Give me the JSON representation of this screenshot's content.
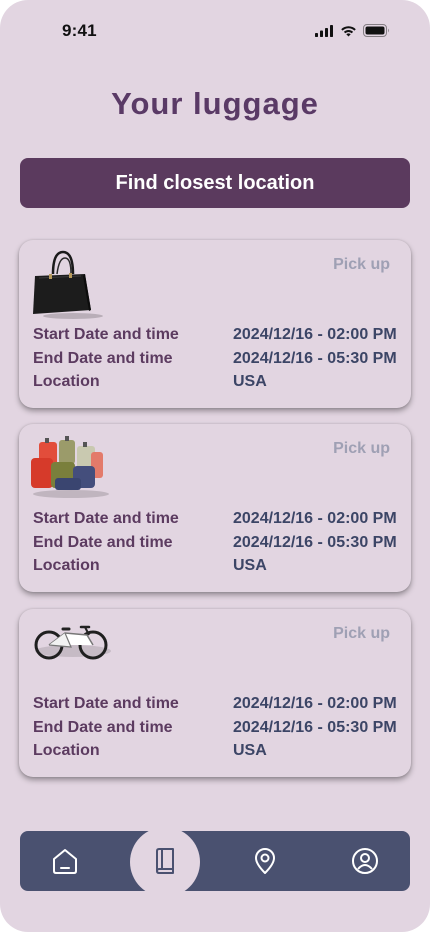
{
  "status_bar": {
    "time": "9:41",
    "icons": [
      "cellular-signal-icon",
      "wifi-icon",
      "battery-icon"
    ]
  },
  "page": {
    "title": "Your luggage"
  },
  "find_button": {
    "label": "Find closest location"
  },
  "cards": [
    {
      "image": "handbag-image",
      "action": "Pick up",
      "start_label": "Start Date and time",
      "start_value": "2024/12/16 - 02:00 PM",
      "end_label": "End Date and time",
      "end_value": "2024/12/16 - 05:30 PM",
      "location_label": "Location",
      "location_value": "USA"
    },
    {
      "image": "suitcases-pile-image",
      "action": "Pick up",
      "start_label": "Start Date and time",
      "start_value": "2024/12/16 - 02:00 PM",
      "end_label": "End Date and time",
      "end_value": "2024/12/16 - 05:30 PM",
      "location_label": "Location",
      "location_value": "USA"
    },
    {
      "image": "bicycle-image",
      "action": "Pick up",
      "start_label": "Start Date and time",
      "start_value": "2024/12/16 - 02:00 PM",
      "end_label": "End Date and time",
      "end_value": "2024/12/16 - 05:30 PM",
      "location_label": "Location",
      "location_value": "USA"
    }
  ],
  "bottom_nav": {
    "items": [
      "home-icon",
      "luggage-book-icon",
      "location-pin-icon",
      "profile-icon"
    ],
    "active_index": 1
  },
  "colors": {
    "background": "#e2d5e1",
    "primary": "#5b3a5e",
    "nav": "#4a5170",
    "label": "#5c3b60",
    "value": "#3c4566",
    "pickup": "#9fa0b4"
  }
}
